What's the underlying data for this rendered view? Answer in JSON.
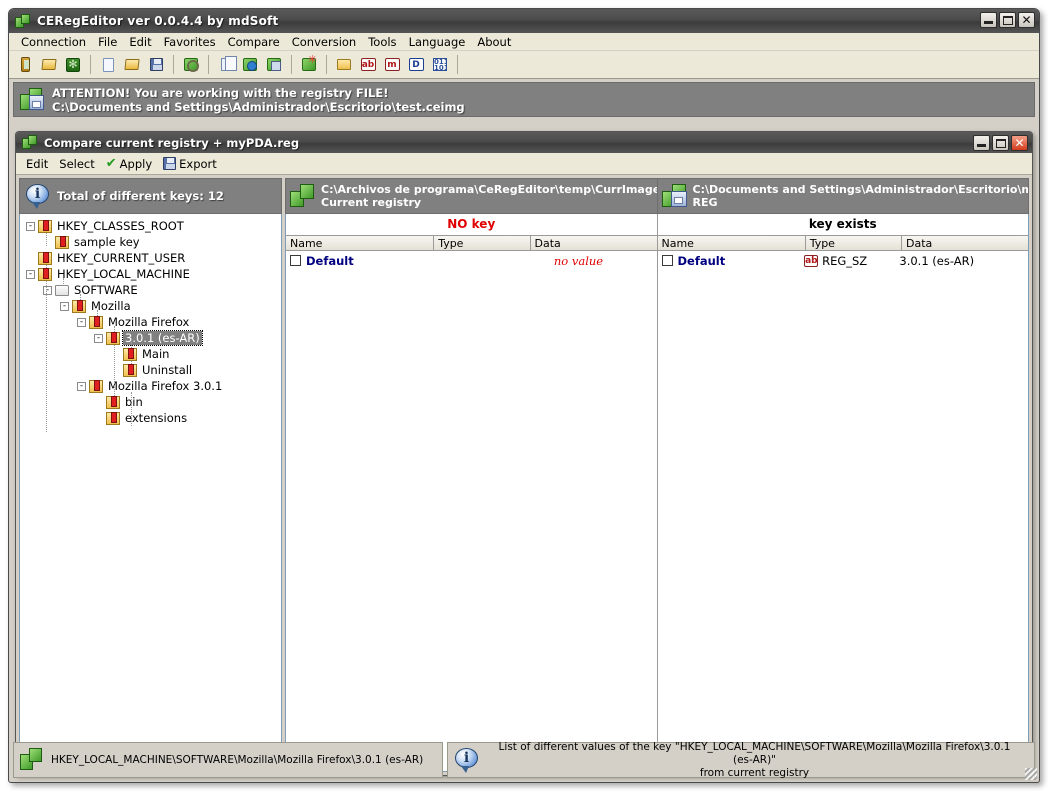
{
  "window": {
    "title": "CERegEditor ver 0.0.4.4 by mdSoft",
    "icon": "app-logo-icon",
    "minimize": "–",
    "maximize": "□",
    "close": "✕"
  },
  "menubar": {
    "items": [
      {
        "label": "Connection"
      },
      {
        "label": "File"
      },
      {
        "label": "Edit"
      },
      {
        "label": "Favorites"
      },
      {
        "label": "Compare"
      },
      {
        "label": "Conversion"
      },
      {
        "label": "Tools"
      },
      {
        "label": "Language"
      },
      {
        "label": "About"
      }
    ]
  },
  "toolbar": {
    "buttons": [
      {
        "name": "connect-device-icon",
        "glyph": "pda"
      },
      {
        "name": "disconnect-device-icon",
        "glyph": "pda-off"
      },
      {
        "name": "refresh-registry-icon",
        "glyph": "snow"
      },
      {
        "name": "new-file-icon",
        "glyph": "doc"
      },
      {
        "name": "open-file-icon",
        "glyph": "folder-open"
      },
      {
        "name": "save-file-icon",
        "glyph": "save"
      },
      {
        "name": "search-registry-icon",
        "glyph": "green-search"
      },
      {
        "name": "copy-icon",
        "glyph": "copy"
      },
      {
        "name": "import-registry-icon",
        "glyph": "green-blue"
      },
      {
        "name": "export-registry-icon",
        "glyph": "green-disk"
      },
      {
        "name": "compare-registry-icon",
        "glyph": "green-star"
      },
      {
        "name": "new-key-icon",
        "glyph": "folder"
      },
      {
        "name": "new-string-value-icon",
        "glyph": "ab"
      },
      {
        "name": "new-multistring-value-icon",
        "glyph": "m"
      },
      {
        "name": "new-dword-value-icon",
        "glyph": "D"
      },
      {
        "name": "new-binary-value-icon",
        "glyph": "bin"
      }
    ]
  },
  "attention": {
    "icon": "registry-file-icon",
    "line1": "ATTENTION! You are working with the registry FILE!",
    "line2": "C:\\Documents and Settings\\Administrador\\Escritorio\\test.ceimg"
  },
  "compare_window": {
    "title": "Compare current registry + myPDA.reg",
    "icon": "app-logo-icon",
    "toolbar": [
      {
        "name": "edit-menu",
        "label": "Edit",
        "icon": null
      },
      {
        "name": "select-menu",
        "label": "Select",
        "icon": null
      },
      {
        "name": "apply-button",
        "label": "Apply",
        "icon": "green-check-icon"
      },
      {
        "name": "export-button",
        "label": "Export",
        "icon": "save-icon"
      }
    ],
    "left_pane": {
      "header_icon": "info-icon",
      "header_text": "Total of different keys: 12",
      "tree": [
        {
          "label": "HKEY_CLASSES_ROOT",
          "depth": 0,
          "expander": "-",
          "icon": "registry-key-icon",
          "selected": false
        },
        {
          "label": "sample key",
          "depth": 1,
          "expander": "",
          "icon": "registry-key-icon",
          "selected": false
        },
        {
          "label": "HKEY_CURRENT_USER",
          "depth": 0,
          "expander": "",
          "icon": "registry-key-icon",
          "selected": false
        },
        {
          "label": "HKEY_LOCAL_MACHINE",
          "depth": 0,
          "expander": "-",
          "icon": "registry-key-icon",
          "selected": false
        },
        {
          "label": "SOFTWARE",
          "depth": 1,
          "expander": "-",
          "icon": "folder-plain-icon",
          "selected": false
        },
        {
          "label": "Mozilla",
          "depth": 2,
          "expander": "-",
          "icon": "registry-key-icon",
          "selected": false
        },
        {
          "label": "Mozilla Firefox",
          "depth": 3,
          "expander": "-",
          "icon": "registry-key-icon",
          "selected": false
        },
        {
          "label": "3.0.1 (es-AR)",
          "depth": 4,
          "expander": "-",
          "icon": "registry-key-icon",
          "selected": true
        },
        {
          "label": "Main",
          "depth": 5,
          "expander": "",
          "icon": "registry-key-icon",
          "selected": false
        },
        {
          "label": "Uninstall",
          "depth": 5,
          "expander": "",
          "icon": "registry-key-icon",
          "selected": false
        },
        {
          "label": "Mozilla Firefox 3.0.1",
          "depth": 3,
          "expander": "-",
          "icon": "registry-key-icon",
          "selected": false
        },
        {
          "label": "bin",
          "depth": 4,
          "expander": "",
          "icon": "registry-key-icon",
          "selected": false
        },
        {
          "label": "extensions",
          "depth": 4,
          "expander": "",
          "icon": "registry-key-icon",
          "selected": false
        }
      ]
    },
    "panels": [
      {
        "icon": "registry-current-icon",
        "line1": "C:\\Archivos de programa\\CeRegEditor\\temp\\CurrImage.Ce",
        "line2": "Current registry",
        "status": "NO key",
        "status_color": "#e00000",
        "columns": [
          "Name",
          "Type",
          "Data"
        ],
        "rows": [
          {
            "checked": false,
            "name": "Default",
            "type": "",
            "type_icon": null,
            "data": "no value",
            "data_style": "novalue"
          }
        ]
      },
      {
        "icon": "registry-file-icon",
        "line1": "C:\\Documents and Settings\\Administrador\\Escritorio\\myPD",
        "line2": "REG",
        "status": "key exists",
        "status_color": "#000000",
        "columns": [
          "Name",
          "Type",
          "Data"
        ],
        "rows": [
          {
            "checked": false,
            "name": "Default",
            "type": "REG_SZ",
            "type_icon": "string-value-icon",
            "data": "3.0.1 (es-AR)",
            "data_style": "normal"
          }
        ]
      }
    ]
  },
  "statusbar": {
    "left_icon": "registry-current-icon",
    "left_text": "HKEY_LOCAL_MACHINE\\SOFTWARE\\Mozilla\\Mozilla Firefox\\3.0.1 (es-AR)",
    "right_icon": "info-icon",
    "right_line1": "List of different values of the key \"HKEY_LOCAL_MACHINE\\SOFTWARE\\Mozilla\\Mozilla Firefox\\3.0.1 (es-AR)\"",
    "right_line2": "from current registry"
  }
}
